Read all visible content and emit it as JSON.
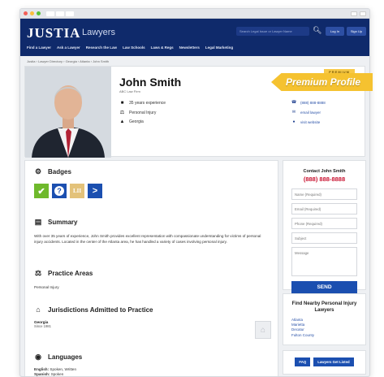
{
  "header": {
    "logo": "JUSTIA",
    "logo_sub": "Lawyers",
    "search_placeholder": "Search Legal Issue or Lawyer Name",
    "login_label": "Log In",
    "signup_label": "Sign Up",
    "nav": [
      "Find a Lawyer",
      "Ask a Lawyer",
      "Research the Law",
      "Law Schools",
      "Laws & Regs",
      "Newsletters",
      "Legal Marketing"
    ]
  },
  "breadcrumb": "Justia › Lawyer Directory › Georgia › Atlanta › John Smith",
  "profile": {
    "premium_tag": "PREMIUM",
    "name": "John Smith",
    "firm": "ABC Law Firm",
    "experience": "35 years experience",
    "practice": "Personal Injury",
    "state": "Georgia",
    "phone": "(888) 888-8888",
    "email_link": "email lawyer",
    "website_link": "visit website",
    "ribbon": "Premium Profile"
  },
  "sections": {
    "badges_title": "Badges",
    "summary_title": "Summary",
    "summary_text": "With over 35 years of experience, John Smith provides excellent representation with compassionate understanding for victims of personal injury accidents. Located in the center of the Atlanta area, he has handled a variety of cases involving personal injury.",
    "practice_title": "Practice Areas",
    "practice_text": "Personal Injury",
    "jurisdictions_title": "Jurisdictions Admitted to Practice",
    "jurisdiction_name": "Georgia",
    "jurisdiction_since": "Since 1981",
    "languages_title": "Languages",
    "lang_english_label": "English:",
    "lang_english_value": "Spoken, Written",
    "lang_spanish_label": "Spanish:",
    "lang_spanish_value": "Spoken"
  },
  "badges": [
    {
      "name": "check-badge-icon",
      "glyph": "✔",
      "color": "#6fb92c"
    },
    {
      "name": "question-badge-icon",
      "glyph": "?",
      "color": "#1b4fb0"
    },
    {
      "name": "lii-badge-icon",
      "glyph": "LII",
      "color": "#e3c27a"
    },
    {
      "name": "arrow-badge-icon",
      "glyph": ">",
      "color": "#1b4fb0"
    }
  ],
  "contact_form": {
    "title": "Contact John Smith",
    "phone": "(888) 888-8888",
    "name_ph": "Name (Required)",
    "email_ph": "Email (Required)",
    "phone_ph": "Phone (Required)",
    "subject_ph": "Subject",
    "message_ph": "Message",
    "send_label": "SEND"
  },
  "nearby": {
    "title": "Find Nearby Personal Injury Lawyers",
    "cities": [
      "Atlanta",
      "Marietta",
      "Decatur",
      "Fulton County"
    ]
  },
  "footer_buttons": {
    "faq": "FAQ",
    "get_listed": "Lawyers Get Listed"
  }
}
